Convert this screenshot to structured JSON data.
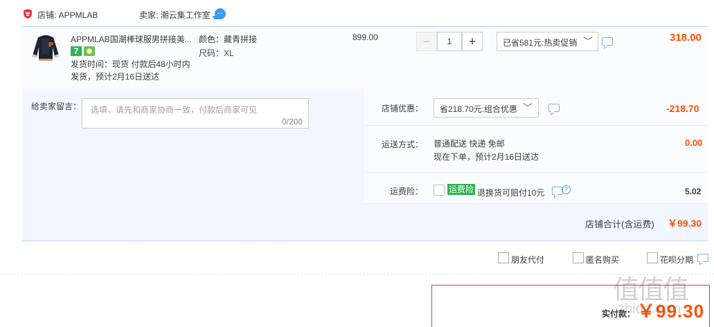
{
  "shop": {
    "label": "店铺: APPMLAB",
    "seller": "卖家: 潮云集工作室",
    "chat_dots": "···"
  },
  "item": {
    "title": "APPMLAB国潮棒球服男拼接美...",
    "badge_seven": "7",
    "ship_time": "发货时间：现货 付款后48小时内",
    "ship_eta": "发货，预计2月16日送达",
    "color_attr": "颜色：藏青拼接",
    "size_attr": "尺码：XL",
    "unit_price": "899.00",
    "qty_minus": "−",
    "qty": "1",
    "qty_plus": "+",
    "promo": "已省581元:热卖促销",
    "total": "318.00"
  },
  "remark": {
    "label": "给卖家留言：",
    "placeholder": "选填，请先和商家协商一致，付款后商家可见",
    "count": "0/200"
  },
  "discount": {
    "label": "店铺优惠：",
    "value": "省218.70元:组合优惠",
    "amount": "-218.70"
  },
  "shipping": {
    "label": "运送方式：",
    "line1": "普通配送 快递 免邮",
    "line2": "现在下单，预计2月16日送达",
    "amount": "0.00"
  },
  "insurance": {
    "label": "运费险：",
    "badge": "运费险",
    "text": "退换货可赔付10元",
    "help": "?",
    "amount": "5.02"
  },
  "store_total": {
    "label": "店铺合计(含运费)",
    "value": "￥99.30"
  },
  "options": {
    "friend_pay": "朋友代付",
    "anonymous": "匿名购买",
    "huabei": "花呗分期"
  },
  "payment": {
    "label": "实付款：",
    "value": "￥99.30"
  },
  "watermark": {
    "logo": "值值值",
    "url": "zhide.com"
  },
  "colors": {
    "accent": "#ff5000",
    "link_blue": "#3b9bf0",
    "green": "#2fb350",
    "panel_bg": "#f2f7ff"
  }
}
